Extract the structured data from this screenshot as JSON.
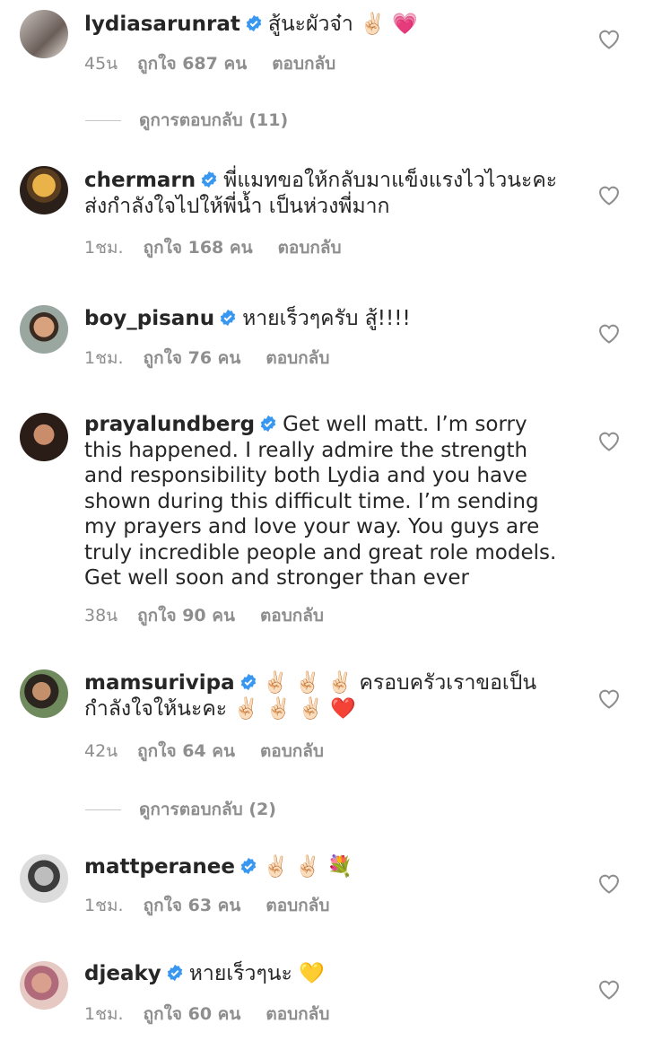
{
  "comments": [
    {
      "username": "lydiasarunrat",
      "text": "สู้นะผัวจ๋า ✌🏻 💗",
      "time": "45น",
      "likes": "ถูกใจ 687 คน",
      "reply": "ตอบกลับ"
    },
    {
      "username": "chermarn",
      "text": "พี่แมทขอให้กลับมาแข็งแรงไวไวนะคะ ส่งกำลังใจไปให้พี่น้ำ เป็นห่วงพี่มาก",
      "time": "1ชม.",
      "likes": "ถูกใจ 168 คน",
      "reply": "ตอบกลับ"
    },
    {
      "username": "boy_pisanu",
      "text": "หายเร็วๆครับ สู้!!!!",
      "time": "1ชม.",
      "likes": "ถูกใจ 76 คน",
      "reply": "ตอบกลับ"
    },
    {
      "username": "prayalundberg",
      "text": "Get well matt. I’m sorry this happened. I really admire the strength and responsibility both Lydia and you have shown during this difficult time. I’m sending my prayers and love your way. You guys are truly incredible people and great role models. Get well soon and stronger than ever",
      "time": "38น",
      "likes": "ถูกใจ 90 คน",
      "reply": "ตอบกลับ"
    },
    {
      "username": "mamsurivipa",
      "text": "✌🏻 ✌🏻 ✌🏻 ครอบครัวเราขอเป็นกำลังใจให้นะคะ ✌🏻 ✌🏻 ✌🏻 ❤️",
      "time": "42น",
      "likes": "ถูกใจ 64 คน",
      "reply": "ตอบกลับ"
    },
    {
      "username": "mattperanee",
      "text": "✌🏻 ✌🏻 💐",
      "time": "1ชม.",
      "likes": "ถูกใจ 63 คน",
      "reply": "ตอบกลับ"
    },
    {
      "username": "djeaky",
      "text": "หายเร็วๆนะ 💛",
      "time": "1ชม.",
      "likes": "ถูกใจ 60 คน",
      "reply": "ตอบกลับ"
    }
  ],
  "view_replies": [
    "ดูการตอบกลับ (11)",
    "ดูการตอบกลับ (2)"
  ],
  "colors": {
    "verified": "#3897f0",
    "meta": "#8e8e8e",
    "text": "#262626"
  }
}
